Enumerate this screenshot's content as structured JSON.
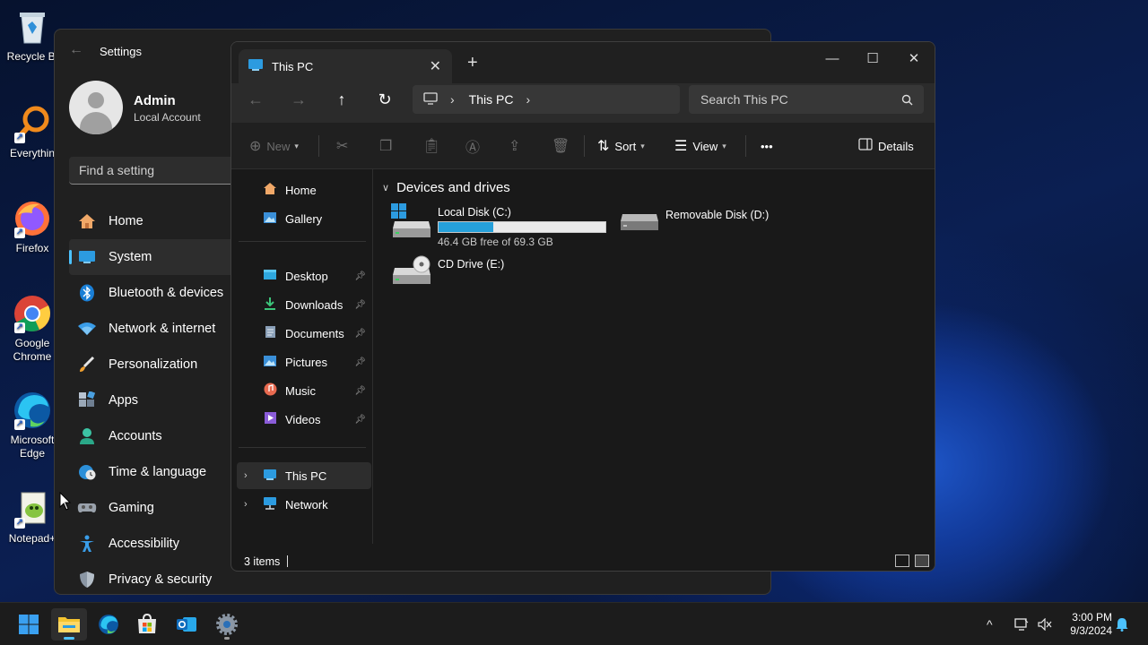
{
  "desktop": {
    "icons": [
      {
        "label": "Recycle Bi",
        "name": "recycle-bin"
      },
      {
        "label": "Everythin",
        "name": "everything"
      },
      {
        "label": "Firefox",
        "name": "firefox"
      },
      {
        "label": "Google Chrome",
        "name": "google-chrome"
      },
      {
        "label": "Microsoft Edge",
        "name": "microsoft-edge"
      },
      {
        "label": "Notepad+",
        "name": "notepad-plus-plus"
      }
    ]
  },
  "settings": {
    "title": "Settings",
    "user": {
      "name": "Admin",
      "account": "Local Account"
    },
    "search_placeholder": "Find a setting",
    "nav": [
      {
        "label": "Home",
        "icon": "home-icon"
      },
      {
        "label": "System",
        "icon": "system-icon",
        "active": true
      },
      {
        "label": "Bluetooth & devices",
        "icon": "bluetooth-icon"
      },
      {
        "label": "Network & internet",
        "icon": "wifi-icon"
      },
      {
        "label": "Personalization",
        "icon": "brush-icon"
      },
      {
        "label": "Apps",
        "icon": "apps-icon"
      },
      {
        "label": "Accounts",
        "icon": "accounts-icon"
      },
      {
        "label": "Time & language",
        "icon": "globe-clock-icon"
      },
      {
        "label": "Gaming",
        "icon": "gamepad-icon"
      },
      {
        "label": "Accessibility",
        "icon": "accessibility-icon"
      },
      {
        "label": "Privacy & security",
        "icon": "shield-icon"
      }
    ]
  },
  "explorer": {
    "tab_title": "This PC",
    "address": {
      "location": "This PC"
    },
    "search_placeholder": "Search This PC",
    "toolbar": {
      "new_label": "New",
      "sort_label": "Sort",
      "view_label": "View",
      "more_label": "•••",
      "details_label": "Details"
    },
    "nav_pane": {
      "top": [
        {
          "label": "Home",
          "icon": "home-icon"
        },
        {
          "label": "Gallery",
          "icon": "gallery-icon"
        }
      ],
      "quick_access": [
        {
          "label": "Desktop",
          "icon": "desktop-folder-icon"
        },
        {
          "label": "Downloads",
          "icon": "downloads-folder-icon"
        },
        {
          "label": "Documents",
          "icon": "documents-folder-icon"
        },
        {
          "label": "Pictures",
          "icon": "pictures-folder-icon"
        },
        {
          "label": "Music",
          "icon": "music-folder-icon"
        },
        {
          "label": "Videos",
          "icon": "videos-folder-icon"
        }
      ],
      "locations": [
        {
          "label": "This PC",
          "icon": "pc-icon",
          "selected": true
        },
        {
          "label": "Network",
          "icon": "network-icon"
        }
      ]
    },
    "group_title": "Devices and drives",
    "drives": [
      {
        "name": "Local Disk (C:)",
        "free_text": "46.4 GB free of 69.3 GB",
        "used_fraction": 0.33
      },
      {
        "name": "Removable Disk (D:)"
      },
      {
        "name": "CD Drive (E:)"
      }
    ],
    "status": {
      "item_count": "3 items"
    }
  },
  "taskbar": {
    "time": "3:00 PM",
    "date": "9/3/2024"
  },
  "colors": {
    "accent": "#4cc2ff",
    "drive_bar_fill": "#26a0da"
  }
}
